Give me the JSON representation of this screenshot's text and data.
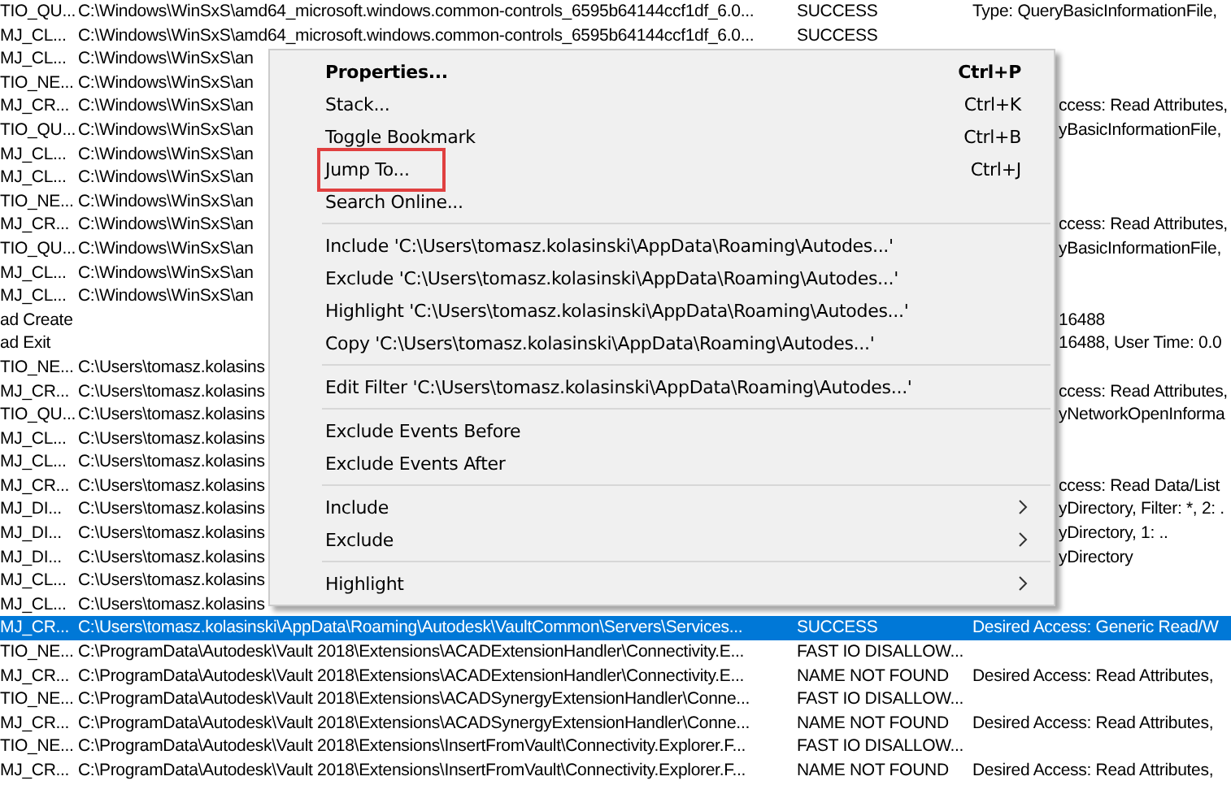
{
  "rows": [
    {
      "kind": "full",
      "selected": false,
      "operation": "TIO_QU...",
      "path": "C:\\Windows\\WinSxS\\amd64_microsoft.windows.common-controls_6595b64144ccf1df_6.0...",
      "result": "SUCCESS",
      "detail": "Type: QueryBasicInformationFile,"
    },
    {
      "kind": "full",
      "selected": false,
      "operation": "MJ_CL...",
      "path": "C:\\Windows\\WinSxS\\amd64_microsoft.windows.common-controls_6595b64144ccf1df_6.0...",
      "result": "SUCCESS"
    },
    {
      "kind": "covered",
      "selected": false,
      "operation": "MJ_CL...",
      "path": "C:\\Windows\\WinSxS\\an"
    },
    {
      "kind": "covered",
      "selected": false,
      "operation": "TIO_NE...",
      "path": "C:\\Windows\\WinSxS\\an"
    },
    {
      "kind": "covered",
      "selected": false,
      "operation": "MJ_CR...",
      "path": "C:\\Windows\\WinSxS\\an",
      "detail": "ccess: Read Attributes,"
    },
    {
      "kind": "covered",
      "selected": false,
      "operation": "TIO_QU...",
      "path": "C:\\Windows\\WinSxS\\an",
      "detail": "yBasicInformationFile,"
    },
    {
      "kind": "covered",
      "selected": false,
      "operation": "MJ_CL...",
      "path": "C:\\Windows\\WinSxS\\an"
    },
    {
      "kind": "covered",
      "selected": false,
      "operation": "MJ_CL...",
      "path": "C:\\Windows\\WinSxS\\an"
    },
    {
      "kind": "covered",
      "selected": false,
      "operation": "TIO_NE...",
      "path": "C:\\Windows\\WinSxS\\an"
    },
    {
      "kind": "covered",
      "selected": false,
      "operation": "MJ_CR...",
      "path": "C:\\Windows\\WinSxS\\an",
      "detail": "ccess: Read Attributes,"
    },
    {
      "kind": "covered",
      "selected": false,
      "operation": "TIO_QU...",
      "path": "C:\\Windows\\WinSxS\\an",
      "detail": "yBasicInformationFile,"
    },
    {
      "kind": "covered",
      "selected": false,
      "operation": "MJ_CL...",
      "path": "C:\\Windows\\WinSxS\\an"
    },
    {
      "kind": "covered",
      "selected": false,
      "operation": "MJ_CL...",
      "path": "C:\\Windows\\WinSxS\\an"
    },
    {
      "kind": "covered",
      "selected": false,
      "operation": "ad Create",
      "detail": "16488"
    },
    {
      "kind": "covered",
      "selected": false,
      "operation": "ad Exit",
      "detail": "16488, User Time: 0.0"
    },
    {
      "kind": "covered",
      "selected": false,
      "operation": "TIO_NE...",
      "path": "C:\\Users\\tomasz.kolasins"
    },
    {
      "kind": "covered",
      "selected": false,
      "operation": "MJ_CR...",
      "path": "C:\\Users\\tomasz.kolasins",
      "detail": "ccess: Read Attributes,"
    },
    {
      "kind": "covered",
      "selected": false,
      "operation": "TIO_QU...",
      "path": "C:\\Users\\tomasz.kolasins",
      "detail": "yNetworkOpenInforma"
    },
    {
      "kind": "covered",
      "selected": false,
      "operation": "MJ_CL...",
      "path": "C:\\Users\\tomasz.kolasins"
    },
    {
      "kind": "covered",
      "selected": false,
      "operation": "MJ_CL...",
      "path": "C:\\Users\\tomasz.kolasins"
    },
    {
      "kind": "covered",
      "selected": false,
      "operation": "MJ_CR...",
      "path": "C:\\Users\\tomasz.kolasins",
      "detail": "ccess: Read Data/List"
    },
    {
      "kind": "covered",
      "selected": false,
      "operation": "MJ_DI...",
      "path": "C:\\Users\\tomasz.kolasins",
      "detail": "yDirectory, Filter: *, 2: ."
    },
    {
      "kind": "covered",
      "selected": false,
      "operation": "MJ_DI...",
      "path": "C:\\Users\\tomasz.kolasins",
      "detail": "yDirectory, 1: .."
    },
    {
      "kind": "covered",
      "selected": false,
      "operation": "MJ_DI...",
      "path": "C:\\Users\\tomasz.kolasins",
      "detail": "yDirectory"
    },
    {
      "kind": "covered",
      "selected": false,
      "operation": "MJ_CL...",
      "path": "C:\\Users\\tomasz.kolasins"
    },
    {
      "kind": "covered",
      "selected": false,
      "operation": "MJ_CL...",
      "path": "C:\\Users\\tomasz.kolasins"
    },
    {
      "kind": "full",
      "selected": true,
      "operation": "MJ_CR...",
      "path": "C:\\Users\\tomasz.kolasinski\\AppData\\Roaming\\Autodesk\\VaultCommon\\Servers\\Services...",
      "result": "SUCCESS",
      "detail": "Desired Access: Generic Read/W"
    },
    {
      "kind": "full",
      "selected": false,
      "operation": "TIO_NE...",
      "path": "C:\\ProgramData\\Autodesk\\Vault 2018\\Extensions\\ACADExtensionHandler\\Connectivity.E...",
      "result": "FAST IO DISALLOW..."
    },
    {
      "kind": "full",
      "selected": false,
      "operation": "MJ_CR...",
      "path": "C:\\ProgramData\\Autodesk\\Vault 2018\\Extensions\\ACADExtensionHandler\\Connectivity.E...",
      "result": "NAME NOT FOUND",
      "detail": "Desired Access: Read Attributes,"
    },
    {
      "kind": "full",
      "selected": false,
      "operation": "TIO_NE...",
      "path": "C:\\ProgramData\\Autodesk\\Vault 2018\\Extensions\\ACADSynergyExtensionHandler\\Conne...",
      "result": "FAST IO DISALLOW..."
    },
    {
      "kind": "full",
      "selected": false,
      "operation": "MJ_CR...",
      "path": "C:\\ProgramData\\Autodesk\\Vault 2018\\Extensions\\ACADSynergyExtensionHandler\\Conne...",
      "result": "NAME NOT FOUND",
      "detail": "Desired Access: Read Attributes,"
    },
    {
      "kind": "full",
      "selected": false,
      "operation": "TIO_NE...",
      "path": "C:\\ProgramData\\Autodesk\\Vault 2018\\Extensions\\InsertFromVault\\Connectivity.Explorer.F...",
      "result": "FAST IO DISALLOW..."
    },
    {
      "kind": "full",
      "selected": false,
      "operation": "MJ_CR...",
      "path": "C:\\ProgramData\\Autodesk\\Vault 2018\\Extensions\\InsertFromVault\\Connectivity.Explorer.F...",
      "result": "NAME NOT FOUND",
      "detail": "Desired Access: Read Attributes,"
    }
  ],
  "context_menu": {
    "groups": [
      [
        {
          "label": "Properties...",
          "shortcut": "Ctrl+P",
          "default": true,
          "submenu": false,
          "annotated": false
        },
        {
          "label": "Stack...",
          "shortcut": "Ctrl+K",
          "default": false,
          "submenu": false,
          "annotated": false
        },
        {
          "label": "Toggle Bookmark",
          "shortcut": "Ctrl+B",
          "default": false,
          "submenu": false,
          "annotated": false
        },
        {
          "label": "Jump To...",
          "shortcut": "Ctrl+J",
          "default": false,
          "submenu": false,
          "annotated": true
        },
        {
          "label": "Search Online...",
          "default": false,
          "submenu": false,
          "annotated": false
        }
      ],
      [
        {
          "label": "Include 'C:\\Users\\tomasz.kolasinski\\AppData\\Roaming\\Autodes...'",
          "default": false,
          "submenu": false,
          "annotated": false
        },
        {
          "label": "Exclude 'C:\\Users\\tomasz.kolasinski\\AppData\\Roaming\\Autodes...'",
          "default": false,
          "submenu": false,
          "annotated": false
        },
        {
          "label": "Highlight 'C:\\Users\\tomasz.kolasinski\\AppData\\Roaming\\Autodes...'",
          "default": false,
          "submenu": false,
          "annotated": false
        },
        {
          "label": "Copy 'C:\\Users\\tomasz.kolasinski\\AppData\\Roaming\\Autodes...'",
          "default": false,
          "submenu": false,
          "annotated": false
        }
      ],
      [
        {
          "label": "Edit Filter 'C:\\Users\\tomasz.kolasinski\\AppData\\Roaming\\Autodes...'",
          "default": false,
          "submenu": false,
          "annotated": false
        }
      ],
      [
        {
          "label": "Exclude Events Before",
          "default": false,
          "submenu": false,
          "annotated": false
        },
        {
          "label": "Exclude Events After",
          "default": false,
          "submenu": false,
          "annotated": false
        }
      ],
      [
        {
          "label": "Include",
          "default": false,
          "submenu": true,
          "annotated": false
        },
        {
          "label": "Exclude",
          "default": false,
          "submenu": true,
          "annotated": false
        }
      ],
      [
        {
          "label": "Highlight",
          "default": false,
          "submenu": true,
          "annotated": false
        }
      ]
    ]
  }
}
